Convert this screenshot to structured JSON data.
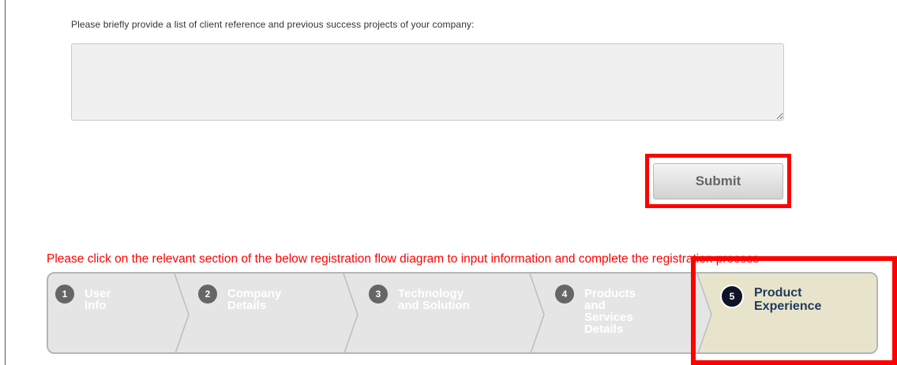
{
  "form": {
    "question": "Please briefly provide a list of client reference and previous success projects of your company:",
    "answer_value": "",
    "submit_label": "Submit"
  },
  "instruction": "Please click on the relevant section of the below registration flow diagram to input information and complete the registration process",
  "flow": {
    "steps": [
      {
        "num": "1",
        "label": "User Info"
      },
      {
        "num": "2",
        "label": "Company Details"
      },
      {
        "num": "3",
        "label": "Technology and Solution"
      },
      {
        "num": "4",
        "label": "Products and Services Details"
      },
      {
        "num": "5",
        "label": "Product Experience"
      }
    ],
    "active_step": "5"
  },
  "colors": {
    "highlight": "#ff0000",
    "instruction": "#ff0000",
    "active_step_bg": "#e8e4cc",
    "inactive_step_bg": "#e5e5e5"
  }
}
